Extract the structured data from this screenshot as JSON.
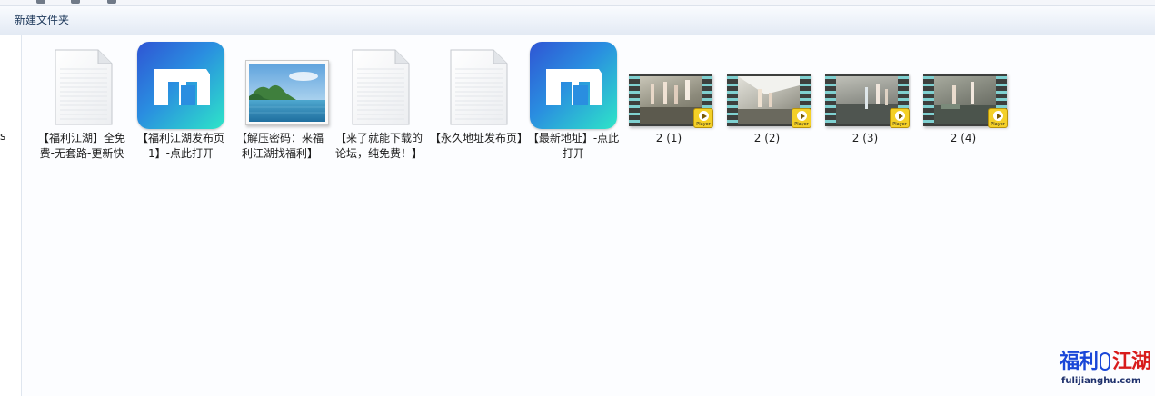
{
  "toolbar": {
    "new_folder_label": "新建文件夹"
  },
  "nav_pane": {
    "clipped_text": "s"
  },
  "files": [
    {
      "label": "【福利江湖】全免费-无套路-更新快",
      "type": "document",
      "icon": "document-icon"
    },
    {
      "label": "【福利江湖发布页1】-点此打开",
      "type": "app",
      "icon": "maxthon-browser-icon"
    },
    {
      "label": "【解压密码：来福利江湖找福利】",
      "type": "image",
      "icon": "landscape-image-icon"
    },
    {
      "label": "【来了就能下载的论坛，纯免费！】",
      "type": "document",
      "icon": "document-icon"
    },
    {
      "label": "【永久地址发布页】",
      "type": "document",
      "icon": "document-icon"
    },
    {
      "label": "【最新地址】-点此打开",
      "type": "app",
      "icon": "maxthon-browser-icon"
    },
    {
      "label": "2 (1)",
      "type": "video",
      "icon": "video-thumbnail-icon",
      "badge": "Player"
    },
    {
      "label": "2 (2)",
      "type": "video",
      "icon": "video-thumbnail-icon",
      "badge": "Player"
    },
    {
      "label": "2 (3)",
      "type": "video",
      "icon": "video-thumbnail-icon",
      "badge": "Player"
    },
    {
      "label": "2 (4)",
      "type": "video",
      "icon": "video-thumbnail-icon",
      "badge": "Player"
    }
  ],
  "watermark": {
    "title_part1": "福利",
    "title_part2": "江湖",
    "url": "fulijianghu.com",
    "color_part1": "#1a47d8",
    "color_part2": "#d81b1b"
  },
  "colors": {
    "toolbar_text": "#1e395b",
    "app_icon_gradient_start": "#2f55d4",
    "app_icon_gradient_end": "#2ee5c8",
    "player_badge": "#f4d027"
  }
}
